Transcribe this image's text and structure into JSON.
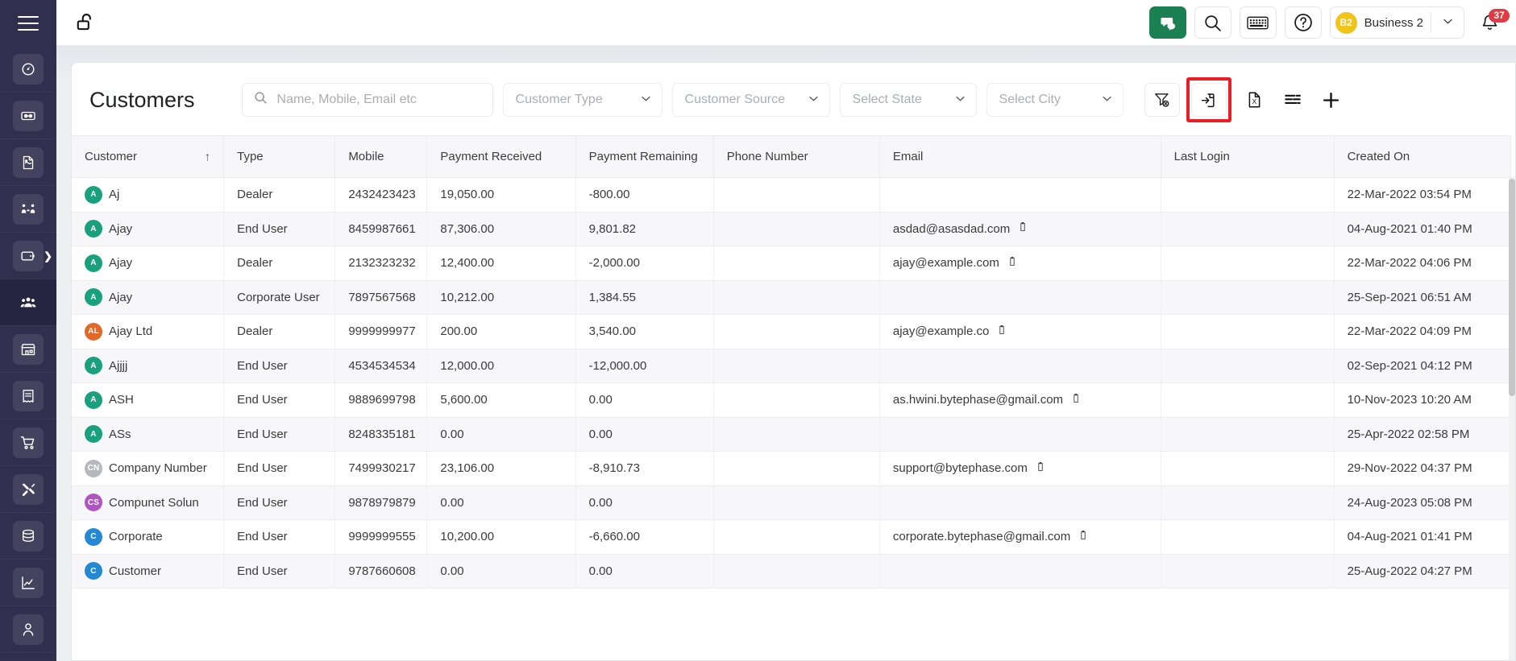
{
  "sidebar": {
    "menu_icon": "hamburger-menu-icon",
    "items": [
      {
        "icon": "dashboard-gauge-icon",
        "name": "dashboard",
        "active": false,
        "chevron": false
      },
      {
        "icon": "ticket-icon",
        "name": "tickets",
        "active": false,
        "chevron": false
      },
      {
        "icon": "invoice-document-icon",
        "name": "invoices",
        "active": false,
        "chevron": false
      },
      {
        "icon": "people-handshake-icon",
        "name": "leads",
        "active": false,
        "chevron": false
      },
      {
        "icon": "wallet-icon",
        "name": "payments",
        "active": false,
        "chevron": true
      },
      {
        "icon": "customers-group-icon",
        "name": "customers",
        "active": true,
        "chevron": false
      },
      {
        "icon": "store-icon",
        "name": "store",
        "active": false,
        "chevron": false
      },
      {
        "icon": "receipt-icon",
        "name": "receipts",
        "active": false,
        "chevron": false
      },
      {
        "icon": "shopping-cart-icon",
        "name": "orders",
        "active": false,
        "chevron": false
      },
      {
        "icon": "tools-icon",
        "name": "services",
        "active": false,
        "chevron": false
      },
      {
        "icon": "database-icon",
        "name": "inventory",
        "active": false,
        "chevron": false
      },
      {
        "icon": "chart-line-icon",
        "name": "reports",
        "active": false,
        "chevron": false
      },
      {
        "icon": "user-account-icon",
        "name": "account",
        "active": false,
        "chevron": false
      }
    ]
  },
  "topbar": {
    "lock_icon": "unlocked-padlock-icon",
    "chat_icon": "chat-bubbles-icon",
    "search_icon": "search-magnifier-icon",
    "keyboard_icon": "keyboard-icon",
    "help_icon": "question-circle-icon",
    "org": {
      "initials": "B2",
      "name": "Business 2",
      "caret_icon": "chevron-down-icon",
      "avatar_color": "#f0c419"
    },
    "notifications": {
      "icon": "bell-icon",
      "count": "37",
      "badge_color": "#e23a43"
    },
    "accent_color": "#1b8152"
  },
  "page": {
    "title": "Customers"
  },
  "filters": {
    "search": {
      "placeholder": "Name, Mobile, Email etc",
      "value": "",
      "icon": "search-magnifier-icon"
    },
    "customer_type": {
      "label": "Customer Type",
      "value": "",
      "icon": "chevron-down-icon"
    },
    "customer_source": {
      "label": "Customer Source",
      "value": "",
      "icon": "chevron-down-icon"
    },
    "state": {
      "label": "Select State",
      "value": "",
      "icon": "chevron-down-icon"
    },
    "city": {
      "label": "Select City",
      "value": "",
      "icon": "chevron-down-icon"
    }
  },
  "toolbar_actions": [
    {
      "name": "clear-filter-button",
      "icon": "funnel-clear-icon",
      "highlighted": false
    },
    {
      "name": "import-button",
      "icon": "import-file-icon",
      "highlighted": true
    },
    {
      "name": "export-excel-button",
      "icon": "excel-file-icon",
      "highlighted": false
    },
    {
      "name": "column-settings-button",
      "icon": "list-lines-icon",
      "highlighted": false
    },
    {
      "name": "add-customer-button",
      "icon": "plus-icon",
      "highlighted": false
    }
  ],
  "highlight_color": "#ee1c24",
  "table": {
    "columns": [
      {
        "key": "customer",
        "label": "Customer",
        "sorted": true,
        "sort_icon": "arrow-up-icon"
      },
      {
        "key": "type",
        "label": "Type",
        "sorted": false
      },
      {
        "key": "mobile",
        "label": "Mobile",
        "sorted": false
      },
      {
        "key": "payment_received",
        "label": "Payment Received",
        "sorted": false
      },
      {
        "key": "payment_remaining",
        "label": "Payment Remaining",
        "sorted": false
      },
      {
        "key": "phone_number",
        "label": "Phone Number",
        "sorted": false
      },
      {
        "key": "email",
        "label": "Email",
        "sorted": false
      },
      {
        "key": "last_login",
        "label": "Last Login",
        "sorted": false
      },
      {
        "key": "created_on",
        "label": "Created On",
        "sorted": false
      }
    ],
    "rows": [
      {
        "initials": "A",
        "avatar_color": "#19a07c",
        "customer": "Aj",
        "type": "Dealer",
        "mobile": "2432423423",
        "payment_received": "19,050.00",
        "payment_remaining": "-800.00",
        "phone_number": "",
        "email": "",
        "last_login": "",
        "created_on": "22-Mar-2022 03:54 PM"
      },
      {
        "initials": "A",
        "avatar_color": "#19a07c",
        "customer": "Ajay",
        "type": "End User",
        "mobile": "8459987661",
        "payment_received": "87,306.00",
        "payment_remaining": "9,801.82",
        "phone_number": "",
        "email": "asdad@asasdad.com",
        "last_login": "",
        "created_on": "04-Aug-2021 01:40 PM"
      },
      {
        "initials": "A",
        "avatar_color": "#19a07c",
        "customer": "Ajay",
        "type": "Dealer",
        "mobile": "2132323232",
        "payment_received": "12,400.00",
        "payment_remaining": "-2,000.00",
        "phone_number": "",
        "email": "ajay@example.com",
        "last_login": "",
        "created_on": "22-Mar-2022 04:06 PM"
      },
      {
        "initials": "A",
        "avatar_color": "#19a07c",
        "customer": "Ajay",
        "type": "Corporate User",
        "mobile": "7897567568",
        "payment_received": "10,212.00",
        "payment_remaining": "1,384.55",
        "phone_number": "",
        "email": "",
        "last_login": "",
        "created_on": "25-Sep-2021 06:51 AM"
      },
      {
        "initials": "AL",
        "avatar_color": "#e2682a",
        "customer": "Ajay Ltd",
        "type": "Dealer",
        "mobile": "9999999977",
        "payment_received": "200.00",
        "payment_remaining": "3,540.00",
        "phone_number": "",
        "email": "ajay@example.co",
        "last_login": "",
        "created_on": "22-Mar-2022 04:09 PM"
      },
      {
        "initials": "A",
        "avatar_color": "#19a07c",
        "customer": "Ajjjj",
        "type": "End User",
        "mobile": "4534534534",
        "payment_received": "12,000.00",
        "payment_remaining": "-12,000.00",
        "phone_number": "",
        "email": "",
        "last_login": "",
        "created_on": "02-Sep-2021 04:12 PM"
      },
      {
        "initials": "A",
        "avatar_color": "#19a07c",
        "customer": "ASH",
        "type": "End User",
        "mobile": "9889699798",
        "payment_received": "5,600.00",
        "payment_remaining": "0.00",
        "phone_number": "",
        "email": "as.hwini.bytephase@gmail.com",
        "last_login": "",
        "created_on": "10-Nov-2023 10:20 AM"
      },
      {
        "initials": "A",
        "avatar_color": "#19a07c",
        "customer": "ASs",
        "type": "End User",
        "mobile": "8248335181",
        "payment_received": "0.00",
        "payment_remaining": "0.00",
        "phone_number": "",
        "email": "",
        "last_login": "",
        "created_on": "25-Apr-2022 02:58 PM"
      },
      {
        "initials": "CN",
        "avatar_color": "#b6b8bd",
        "customer": "Company Number",
        "type": "End User",
        "mobile": "7499930217",
        "payment_received": "23,106.00",
        "payment_remaining": "-8,910.73",
        "phone_number": "",
        "email": "support@bytephase.com",
        "last_login": "",
        "created_on": "29-Nov-2022 04:37 PM"
      },
      {
        "initials": "CS",
        "avatar_color": "#b055bf",
        "customer": "Compunet Solun",
        "type": "End User",
        "mobile": "9878979879",
        "payment_received": "0.00",
        "payment_remaining": "0.00",
        "phone_number": "",
        "email": "",
        "last_login": "",
        "created_on": "24-Aug-2023 05:08 PM"
      },
      {
        "initials": "C",
        "avatar_color": "#2389d4",
        "customer": "Corporate",
        "type": "End User",
        "mobile": "9999999555",
        "payment_received": "10,200.00",
        "payment_remaining": "-6,660.00",
        "phone_number": "",
        "email": "corporate.bytephase@gmail.com",
        "last_login": "",
        "created_on": "04-Aug-2021 01:41 PM"
      },
      {
        "initials": "C",
        "avatar_color": "#2389d4",
        "customer": "Customer",
        "type": "End User",
        "mobile": "9787660608",
        "payment_received": "0.00",
        "payment_remaining": "0.00",
        "phone_number": "",
        "email": "",
        "last_login": "",
        "created_on": "25-Aug-2022 04:27 PM"
      }
    ]
  }
}
